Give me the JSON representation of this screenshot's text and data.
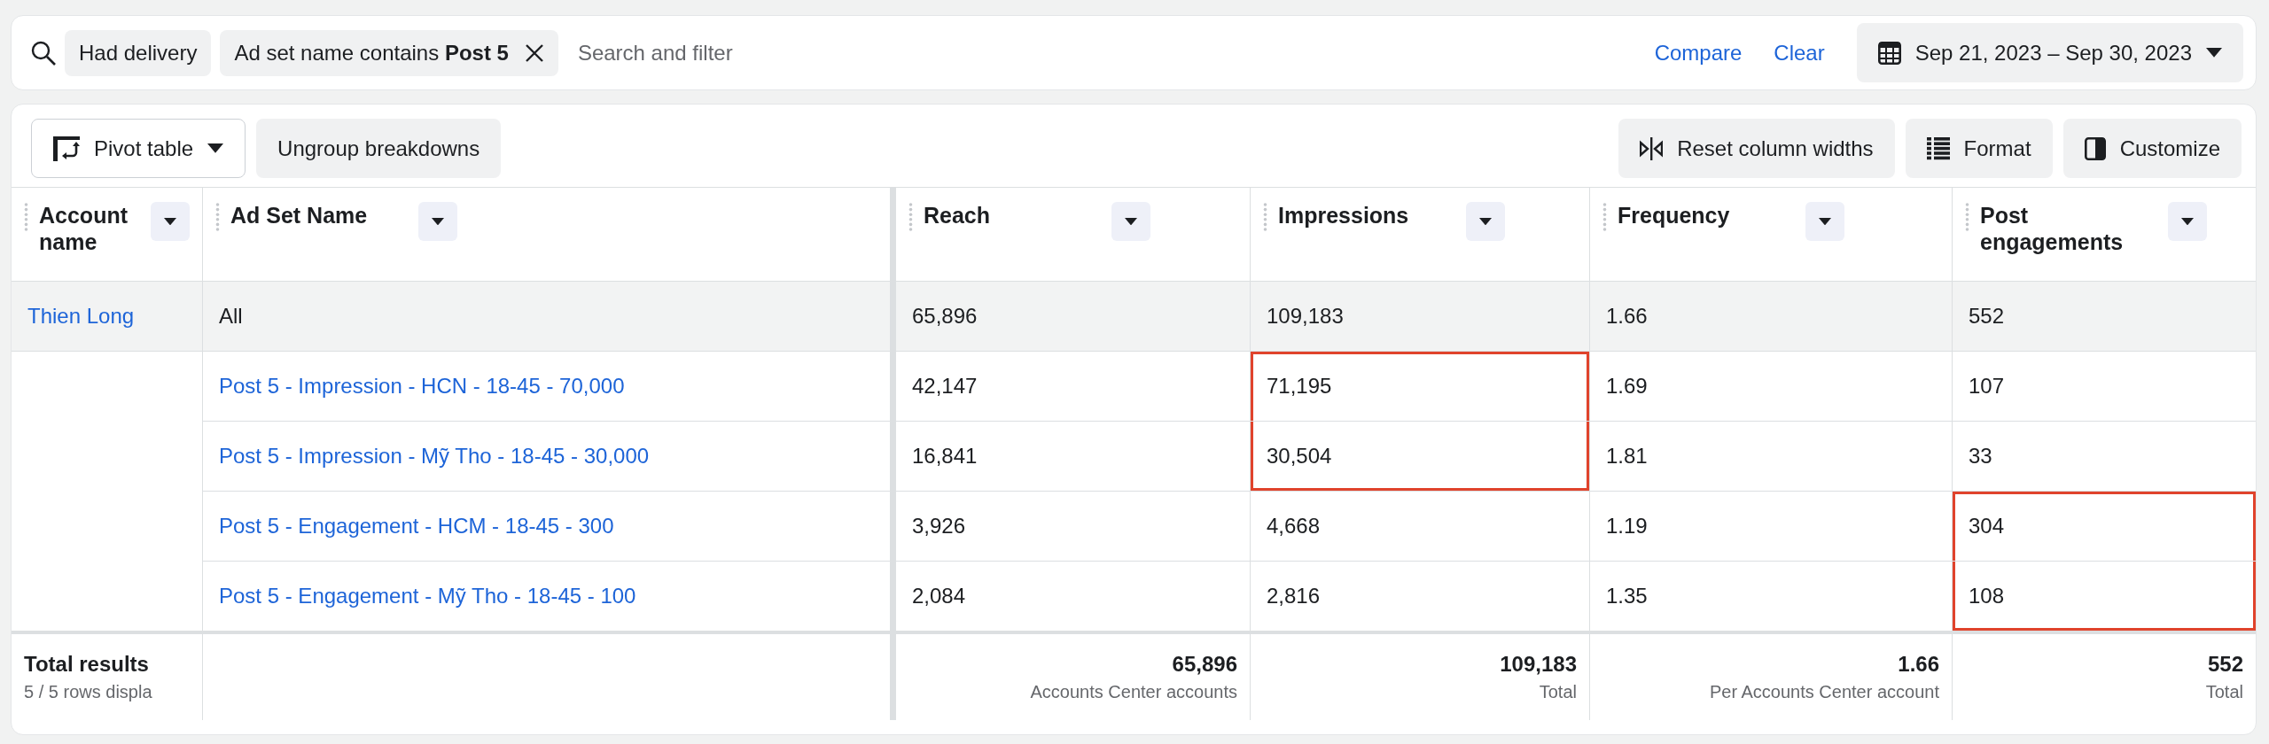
{
  "filter_bar": {
    "chips": [
      {
        "text": "Had delivery",
        "removable": false
      },
      {
        "text": "Ad set name contains **Post 5**",
        "removable": true
      }
    ],
    "search": {
      "placeholder": "Search and filter"
    },
    "links": [
      "Compare",
      "Clear"
    ],
    "date_range": "Sep 21, 2023 – Sep 30, 2023"
  },
  "toolbar": {
    "left": [
      {
        "label": "Pivot table",
        "kind": "pivot"
      },
      {
        "label": "Ungroup breakdowns",
        "kind": "plain"
      }
    ],
    "right": [
      {
        "label": "Reset column widths",
        "kind": "reset"
      },
      {
        "label": "Format",
        "kind": "format"
      },
      {
        "label": "Customize",
        "kind": "customize"
      }
    ]
  },
  "table": {
    "columns": [
      {
        "label": "Account name",
        "kind": "text"
      },
      {
        "label": "Ad Set Name",
        "kind": "text"
      },
      {
        "label": "Reach",
        "kind": "metric"
      },
      {
        "label": "Impressions",
        "kind": "metric"
      },
      {
        "label": "Frequency",
        "kind": "metric"
      },
      {
        "label": "Post engagements",
        "kind": "metric"
      }
    ],
    "rows": [
      {
        "kind": "summary",
        "cells": [
          {
            "text": "Thien Long",
            "highlighted": false
          },
          {
            "text": "All",
            "highlighted": false
          },
          {
            "text": "65,896",
            "highlighted": false
          },
          {
            "text": "109,183",
            "highlighted": false
          },
          {
            "text": "1.66",
            "highlighted": false
          },
          {
            "text": "552",
            "highlighted": false
          }
        ]
      },
      {
        "kind": "detail",
        "cells": [
          {
            "text": "",
            "highlighted": false
          },
          {
            "text": "Post 5 - Impression - HCN - 18-45 - 70,000",
            "highlighted": false
          },
          {
            "text": "42,147",
            "highlighted": false
          },
          {
            "text": "71,195",
            "highlighted": true
          },
          {
            "text": "1.69",
            "highlighted": false
          },
          {
            "text": "107",
            "highlighted": false
          }
        ]
      },
      {
        "kind": "detail",
        "cells": [
          {
            "text": "",
            "highlighted": false
          },
          {
            "text": "Post 5 - Impression - Mỹ Tho - 18-45 - 30,000",
            "highlighted": false
          },
          {
            "text": "16,841",
            "highlighted": false
          },
          {
            "text": "30,504",
            "highlighted": true
          },
          {
            "text": "1.81",
            "highlighted": false
          },
          {
            "text": "33",
            "highlighted": false
          }
        ]
      },
      {
        "kind": "detail",
        "cells": [
          {
            "text": "",
            "highlighted": false
          },
          {
            "text": "Post 5 - Engagement - HCM - 18-45 - 300",
            "highlighted": false
          },
          {
            "text": "3,926",
            "highlighted": false
          },
          {
            "text": "4,668",
            "highlighted": false
          },
          {
            "text": "1.19",
            "highlighted": false
          },
          {
            "text": "304",
            "highlighted": true
          }
        ]
      },
      {
        "kind": "detail",
        "cells": [
          {
            "text": "",
            "highlighted": false
          },
          {
            "text": "Post 5 - Engagement - Mỹ Tho - 18-45 - 100",
            "highlighted": false
          },
          {
            "text": "2,084",
            "highlighted": false
          },
          {
            "text": "2,816",
            "highlighted": false
          },
          {
            "text": "1.35",
            "highlighted": false
          },
          {
            "text": "108",
            "highlighted": true
          }
        ]
      }
    ],
    "footer": {
      "label": "Total results",
      "sublabel": "5 / 5 rows displa",
      "totals": [
        {
          "value": "65,896",
          "note": "Accounts Center accounts"
        },
        {
          "value": "109,183",
          "note": "Total"
        },
        {
          "value": "1.66",
          "note": "Per Accounts Center account"
        },
        {
          "value": "552",
          "note": "Total"
        }
      ]
    }
  }
}
